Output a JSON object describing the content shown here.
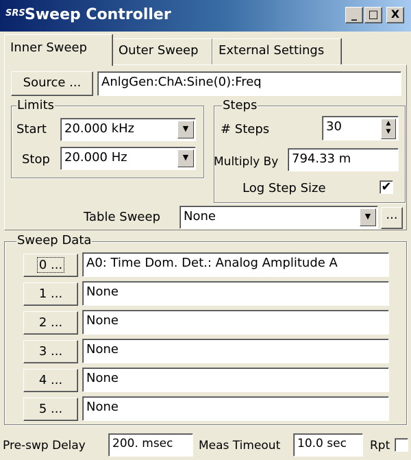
{
  "window": {
    "title": "Sweep Controller",
    "icon_label": "SRS",
    "minimize": "_",
    "maximize": "□",
    "close": "X"
  },
  "tabs": [
    "Inner Sweep",
    "Outer Sweep",
    "External Settings"
  ],
  "source": {
    "button_label": "Source ...",
    "value": "AnlgGen:ChA:Sine(0):Freq"
  },
  "limits": {
    "legend": "Limits",
    "start_label": "Start",
    "start_value": "20.000 kHz",
    "stop_label": "Stop",
    "stop_value": "20.000 Hz"
  },
  "steps": {
    "legend": "Steps",
    "num_steps_label": "# Steps",
    "num_steps_value": "30",
    "multiply_label": "Multiply By",
    "multiply_value": "794.33 m",
    "log_step_label": "Log Step Size",
    "log_step_checked": "✔"
  },
  "table_sweep": {
    "label": "Table Sweep",
    "value": "None",
    "more_label": "..."
  },
  "sweep_data": {
    "legend": "Sweep Data",
    "rows": [
      {
        "button": "0 ...",
        "value": "A0: Time Dom. Det.: Analog Amplitude A"
      },
      {
        "button": "1 ...",
        "value": "None"
      },
      {
        "button": "2 ...",
        "value": "None"
      },
      {
        "button": "3 ...",
        "value": "None"
      },
      {
        "button": "4 ...",
        "value": "None"
      },
      {
        "button": "5 ...",
        "value": "None"
      }
    ]
  },
  "footer": {
    "pre_delay_label": "Pre-swp Delay",
    "pre_delay_value": "200. msec",
    "meas_timeout_label": "Meas Timeout",
    "meas_timeout_value": "10.0 sec",
    "rpt_label": "Rpt"
  }
}
